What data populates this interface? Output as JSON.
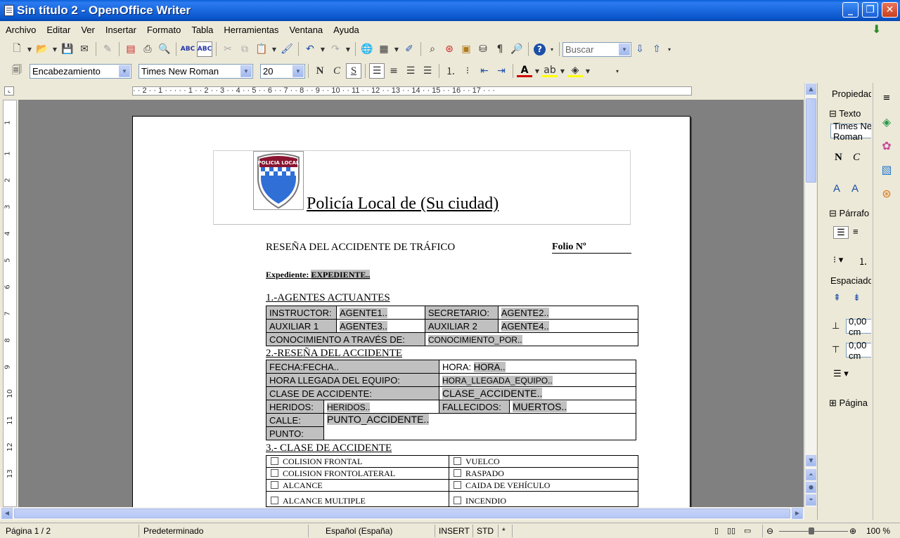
{
  "window": {
    "title": "Sin título 2 - OpenOffice Writer"
  },
  "menu": [
    "Archivo",
    "Editar",
    "Ver",
    "Insertar",
    "Formato",
    "Tabla",
    "Herramientas",
    "Ventana",
    "Ayuda"
  ],
  "toolbar": {
    "search_placeholder": "Buscar"
  },
  "format": {
    "style": "Encabezamiento",
    "font": "Times New Roman",
    "size": "20",
    "bold": "N",
    "italic": "C",
    "underline": "S"
  },
  "ruler": {
    "marks": "· · 2 · · 1 · · · · · 1 · · 2 · · 3 · · 4 · · 5 · · 6 · · 7 · · 8 · · 9 · · 10 · · 11 · · 12 · · 13 · · 14 · · 15 · · 16 · · 17 · · ·"
  },
  "vruler": [
    "1",
    "1",
    "2",
    "3",
    "4",
    "5",
    "6",
    "7",
    "8",
    "9",
    "10",
    "11",
    "12",
    "13"
  ],
  "doc": {
    "header_title": "Policía Local  de (Su ciudad)",
    "logo_text": "POLICIA LOCAL",
    "resena_title": "RESEÑA DEL ACCIDENTE DE TRÁFICO",
    "folio": "Folio Nº",
    "expediente_label": "Expediente:",
    "expediente_value": "EXPEDIENTE..",
    "sec1": "1.-AGENTES ACTUANTES",
    "instructor_l": "INSTRUCTOR:",
    "instructor_v": "AGENTE1..",
    "secretario_l": "SECRETARIO:",
    "secretario_v": "AGENTE2..",
    "aux1_l": "AUXILIAR 1",
    "aux1_v": "AGENTE3..",
    "aux2_l": "AUXILIAR 2",
    "aux2_v": "AGENTE4..",
    "conoc_l": "CONOCIMIENTO A TRAVÉS DE:",
    "conoc_v": "CONOCIMIENTO_POR..",
    "sec2": "2.-RESEÑA DEL ACCIDENTE",
    "fecha_l": "FECHA:",
    "fecha_v": "FECHA..",
    "hora_l": "HORA:",
    "hora_v": "HORA..",
    "llegada_l": "HORA LLEGADA DEL EQUIPO:",
    "llegada_v": "HORA_LLEGADA_EQUIPO..",
    "clase_l": "CLASE DE ACCIDENTE:",
    "clase_v": "CLASE_ACCIDENTE..",
    "heridos_l": "HERIDOS:",
    "heridos_v": "HERIDOS..",
    "fallec_l": "FALLECIDOS:",
    "fallec_v": "MUERTOS..",
    "calle_l": "CALLE:",
    "punto_l": "PUNTO:",
    "punto_v": "PUNTO_ACCIDENTE..",
    "sec3": "3.- CLASE DE ACCIDENTE",
    "checks": [
      [
        "COLISION FRONTAL",
        "VUELCO"
      ],
      [
        "COLISION FRONTOLATERAL",
        "RASPADO"
      ],
      [
        "ALCANCE",
        "CAIDA DE VEHÍCULO"
      ],
      [
        "ALCANCE MULTIPLE",
        "INCENDIO"
      ]
    ]
  },
  "sidebar": {
    "title": "Propiedades",
    "texto": "Texto",
    "font": "Times New Roman",
    "bold": "N",
    "italic": "C",
    "parrafo": "Párrafo",
    "espaciado": "Espaciado",
    "spacing1": "0,00 cm",
    "spacing2": "0,00 cm",
    "pagina": "Página"
  },
  "status": {
    "page": "Página  1 / 2",
    "style": "Predeterminado",
    "lang": "Español (España)",
    "mode": "INSERT",
    "sel": "STD",
    "mod": "*",
    "zoom": "100 %"
  }
}
